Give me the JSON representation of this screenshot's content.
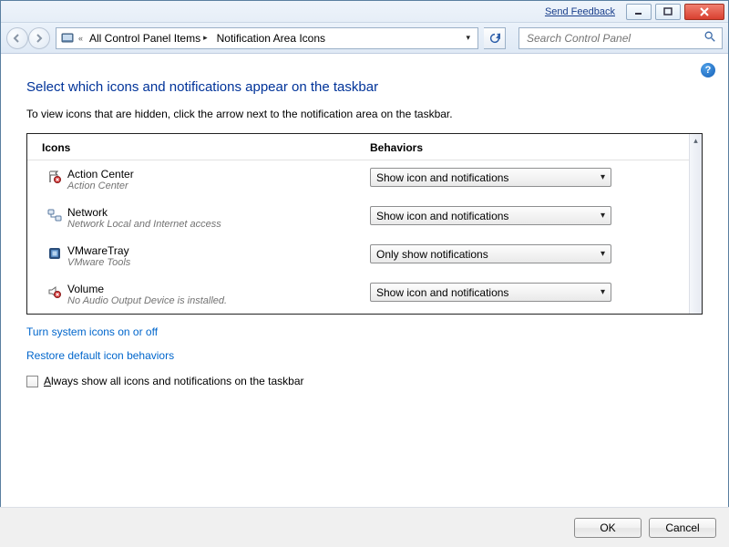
{
  "titlebar": {
    "send_feedback": "Send Feedback"
  },
  "nav": {
    "crumb1": "All Control Panel Items",
    "crumb2": "Notification Area Icons"
  },
  "search": {
    "placeholder": "Search Control Panel"
  },
  "page": {
    "title": "Select which icons and notifications appear on the taskbar",
    "desc": "To view icons that are hidden, click the arrow next to the notification area on the taskbar."
  },
  "headers": {
    "icons": "Icons",
    "behaviors": "Behaviors"
  },
  "rows": [
    {
      "name": "Action Center",
      "sub": "Action Center",
      "behavior": "Show icon and notifications"
    },
    {
      "name": "Network",
      "sub": "Network Local and Internet access",
      "behavior": "Show icon and notifications"
    },
    {
      "name": "VMwareTray",
      "sub": "VMware Tools",
      "behavior": "Only show notifications"
    },
    {
      "name": "Volume",
      "sub": "No Audio Output Device is installed.",
      "behavior": "Show icon and notifications"
    }
  ],
  "links": {
    "system_icons": "Turn system icons on or off",
    "restore": "Restore default icon behaviors"
  },
  "checkbox": {
    "label_pre": "A",
    "label_post": "lways show all icons and notifications on the taskbar"
  },
  "buttons": {
    "ok": "OK",
    "cancel": "Cancel"
  }
}
